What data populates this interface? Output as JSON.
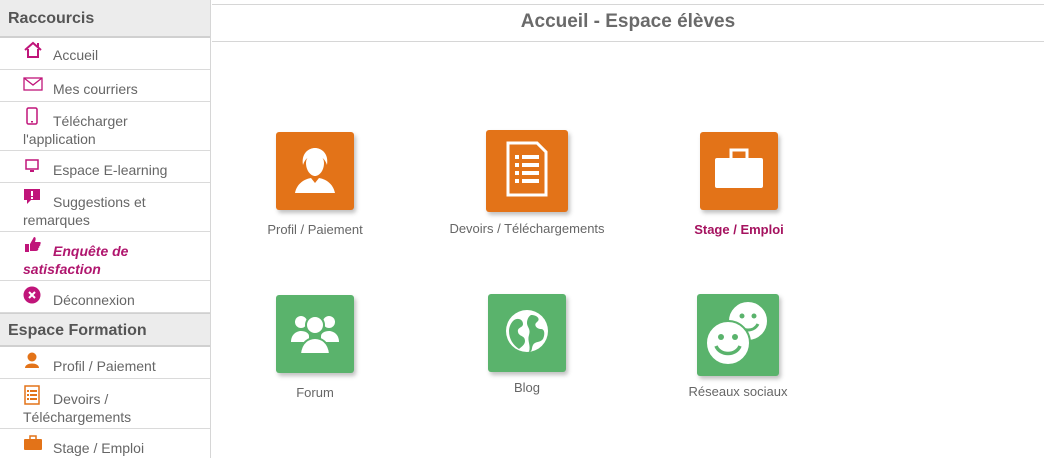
{
  "sidebar": {
    "shortcuts_header": "Raccourcis",
    "shortcuts": [
      {
        "label": "Accueil",
        "icon": "home-icon"
      },
      {
        "label": "Mes courriers",
        "icon": "envelope-icon"
      },
      {
        "label": "Télécharger l'application",
        "icon": "mobile-icon"
      },
      {
        "label": "Espace E-learning",
        "icon": "monitor-icon"
      },
      {
        "label": "Suggestions et remarques",
        "icon": "comment-exclamation-icon"
      },
      {
        "label": "Enquête de satisfaction",
        "icon": "thumbs-up-icon"
      },
      {
        "label": "Déconnexion",
        "icon": "close-circle-icon"
      }
    ],
    "formation_header": "Espace Formation",
    "formation": [
      {
        "label": "Profil / Paiement",
        "icon": "user-icon"
      },
      {
        "label": "Devoirs / Téléchargements",
        "icon": "document-list-icon"
      },
      {
        "label": "Stage / Emploi",
        "icon": "briefcase-icon"
      }
    ]
  },
  "main": {
    "title": "Accueil - Espace élèves",
    "tiles": [
      {
        "label": "Profil / Paiement",
        "icon": "user-icon",
        "color": "#e37318"
      },
      {
        "label": "Devoirs / Téléchargements",
        "icon": "document-list-icon",
        "color": "#e37318"
      },
      {
        "label": "Stage / Emploi",
        "icon": "briefcase-icon",
        "color": "#e37318"
      },
      {
        "label": "Forum",
        "icon": "group-icon",
        "color": "#5ab36c"
      },
      {
        "label": "Blog",
        "icon": "globe-icon",
        "color": "#5ab36c"
      },
      {
        "label": "Réseaux sociaux",
        "icon": "smiley-faces-icon",
        "color": "#5ab36c"
      }
    ]
  },
  "colors": {
    "accent_pink": "#c0157a",
    "tile_orange": "#e37318",
    "tile_green": "#5ab36c"
  }
}
